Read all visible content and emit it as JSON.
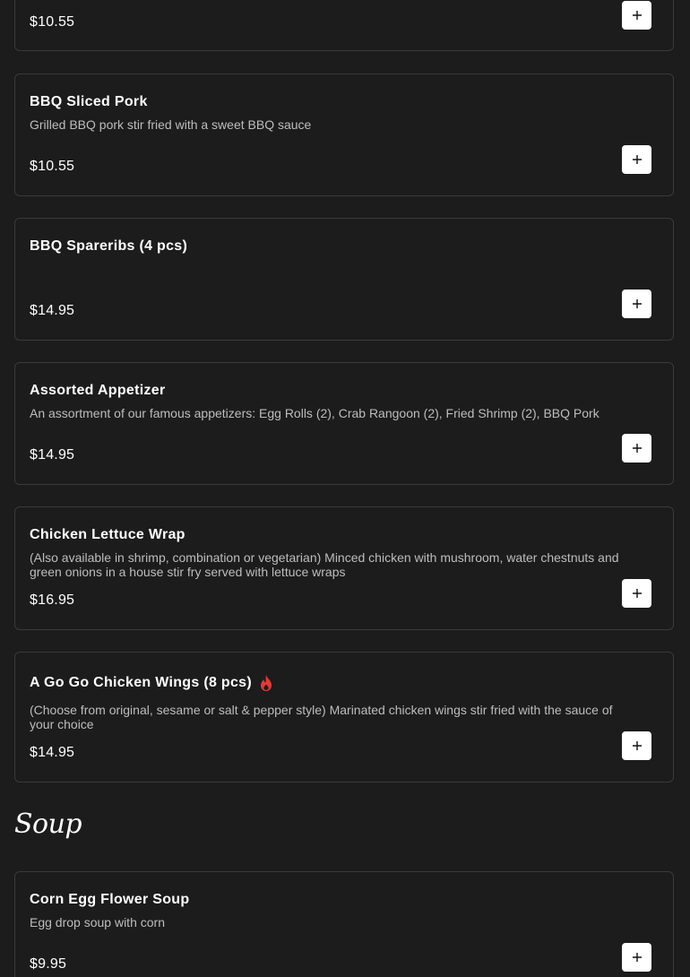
{
  "items": [
    {
      "name": "",
      "description": "",
      "price": "$10.55",
      "add_label": "Add"
    },
    {
      "name": "BBQ Sliced Pork",
      "description": "Grilled BBQ pork stir fried with a sweet BBQ sauce",
      "price": "$10.55",
      "add_label": "Add"
    },
    {
      "name": "BBQ Spareribs (4 pcs)",
      "description": "",
      "price": "$14.95",
      "add_label": "Add"
    },
    {
      "name": "Assorted Appetizer",
      "description": "An assortment of our famous appetizers: Egg Rolls (2), Crab Rangoon (2), Fried Shrimp (2), BBQ Pork",
      "price": "$14.95",
      "add_label": "Add"
    },
    {
      "name": "Chicken Lettuce Wrap",
      "description": "(Also available in shrimp, combination or vegetarian) Minced chicken with mushroom, water chestnuts and green onions in a house stir fry served with lettuce wraps",
      "price": "$16.95",
      "add_label": "Add"
    },
    {
      "name": "A Go Go Chicken Wings (8 pcs)",
      "description": "(Choose from original, sesame or salt & pepper style) Marinated chicken wings stir fried with the sauce of your choice",
      "price": "$14.95",
      "add_label": "Add",
      "badge_icon": "spicy-flame-icon",
      "badge_color": "#e53935"
    }
  ],
  "soup_section": {
    "heading": "Soup",
    "items": [
      {
        "name": "Corn Egg Flower Soup",
        "description": "Egg drop soup with corn",
        "price": "$9.95",
        "add_label": "Add"
      }
    ]
  }
}
